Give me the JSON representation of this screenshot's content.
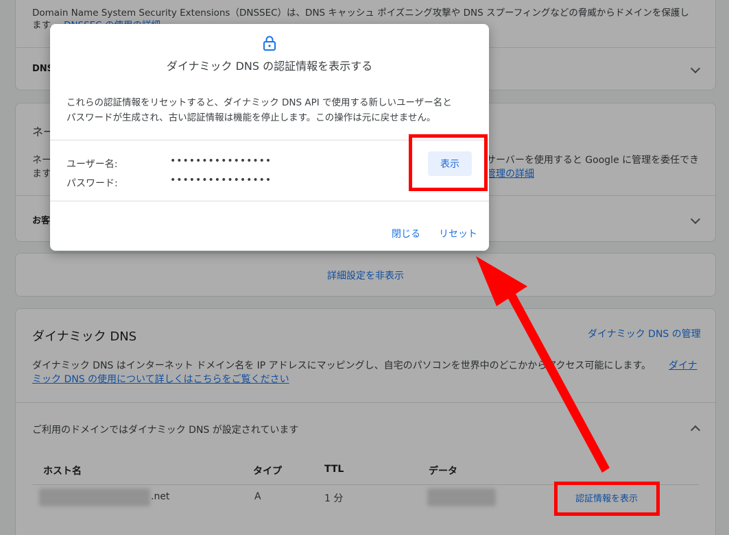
{
  "page": {
    "dnssec_desc_line1": "Domain Name System Security Extensions（DNSSEC）は、DNS キャッシュ ポイズニング攻撃や DNS スプーフィングなどの脅威からドメインを保護し",
    "dnssec_desc_line2": "ます。",
    "dnssec_link": "DNSSEC の使用の詳細",
    "dns_record_row": "DNS",
    "ns_heading": "ネー",
    "ns_desc_left": "ネー",
    "ns_desc_left2": "ます",
    "ns_desc_right": "サーバーを使用すると Google に管理を委任でき",
    "ns_link": "管理の詳細",
    "custom_row": "お客",
    "toggle_advanced": "詳細設定を非表示",
    "ddns": {
      "title": "ダイナミック DNS",
      "manage_link": "ダイナミック DNS の管理",
      "desc_line1": "ダイナミック DNS はインターネット ドメイン名を IP アドレスにマッピングし、自宅のパソコンを世界中のどこかからアクセス可能にします。",
      "desc_link1": "ダイナ",
      "desc_link2": "ミック DNS の使用について詳しくはこちらをご覧ください",
      "configured_label": "ご利用のドメインではダイナミック DNS が設定されています",
      "table": {
        "headers": [
          "ホスト名",
          "タイプ",
          "TTL",
          "データ"
        ],
        "rows": [
          {
            "host_suffix": ".net",
            "type": "A",
            "ttl": "1 分",
            "action": "認証情報を表示"
          }
        ]
      }
    }
  },
  "dialog": {
    "title": "ダイナミック DNS の認証情報を表示する",
    "body_line1": "これらの認証情報をリセットすると、ダイナミック DNS API で使用する新しいユーザー名と",
    "body_line2": "パスワードが生成され、古い認証情報は機能を停止します。この操作は元に戻せません。",
    "username_label": "ユーザー名:",
    "username_value": "••••••••••••••••",
    "password_label": "パスワード:",
    "password_value": "••••••••••••••••",
    "show_button": "表示",
    "close_button": "閉じる",
    "reset_button": "リセット"
  },
  "colors": {
    "accent": "#1a73e8",
    "annotation": "#ff0000"
  }
}
